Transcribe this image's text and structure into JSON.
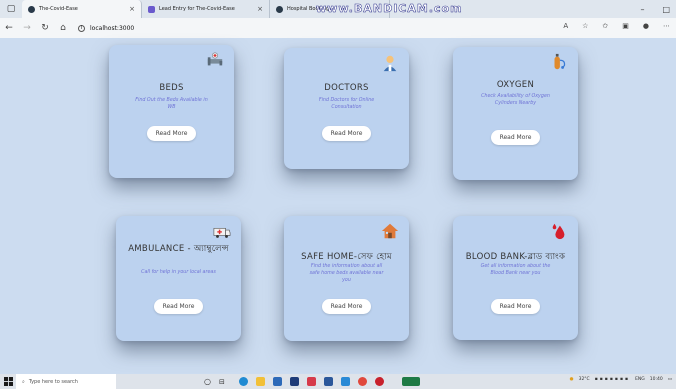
{
  "browser": {
    "tabs": [
      {
        "label": "The-Covid-Ease",
        "active": true,
        "color": "#2a3a4a"
      },
      {
        "label": "Lead Entry for The-Covid-Ease",
        "active": false,
        "color": "#6a5acd"
      },
      {
        "label": "Hospital Booking",
        "active": false,
        "color": "#2a3a4a"
      }
    ],
    "watermark": "www.BANDICAM.com",
    "url": "localhost:3000",
    "window_controls": [
      "–",
      "□"
    ]
  },
  "cards": [
    {
      "id": "beds",
      "title": "BEDS",
      "desc": "Find Out the Beds Available in WB",
      "button": "Read More",
      "icon": "hospital-bed-icon"
    },
    {
      "id": "doctors",
      "title": "DOCTORS",
      "desc": "Find Doctors for Online Consultation",
      "button": "Read More",
      "icon": "doctor-icon"
    },
    {
      "id": "oxygen",
      "title": "OXYGEN",
      "desc": "Check Availability of Oxygen Cylinders Nearby",
      "button": "Read More",
      "icon": "oxygen-cylinder-icon"
    },
    {
      "id": "ambulance",
      "title": "AMBULANCE - অ্যাম্বুলেন্স",
      "desc": "Call for help in your local areas",
      "button": "Read More",
      "icon": "ambulance-icon"
    },
    {
      "id": "safehome",
      "title": "SAFE HOME-সেফ হোম",
      "desc": "Find the information about all safe home beds available near you",
      "button": "Read More",
      "icon": "house-icon"
    },
    {
      "id": "blood",
      "title": "BLOOD BANK-ব্লাড ব্যাংক",
      "desc": "Get all information about the Blood Bank near you",
      "button": "Read More",
      "icon": "blood-drop-icon"
    }
  ],
  "taskbar": {
    "search_placeholder": "Type here to search",
    "weather": "32°C",
    "language": "ENG",
    "time": "10:40"
  },
  "colors": {
    "card_bg": "#bcd2ef",
    "page_bg": "#ccdcf0",
    "desc_text": "#6f73d6"
  }
}
